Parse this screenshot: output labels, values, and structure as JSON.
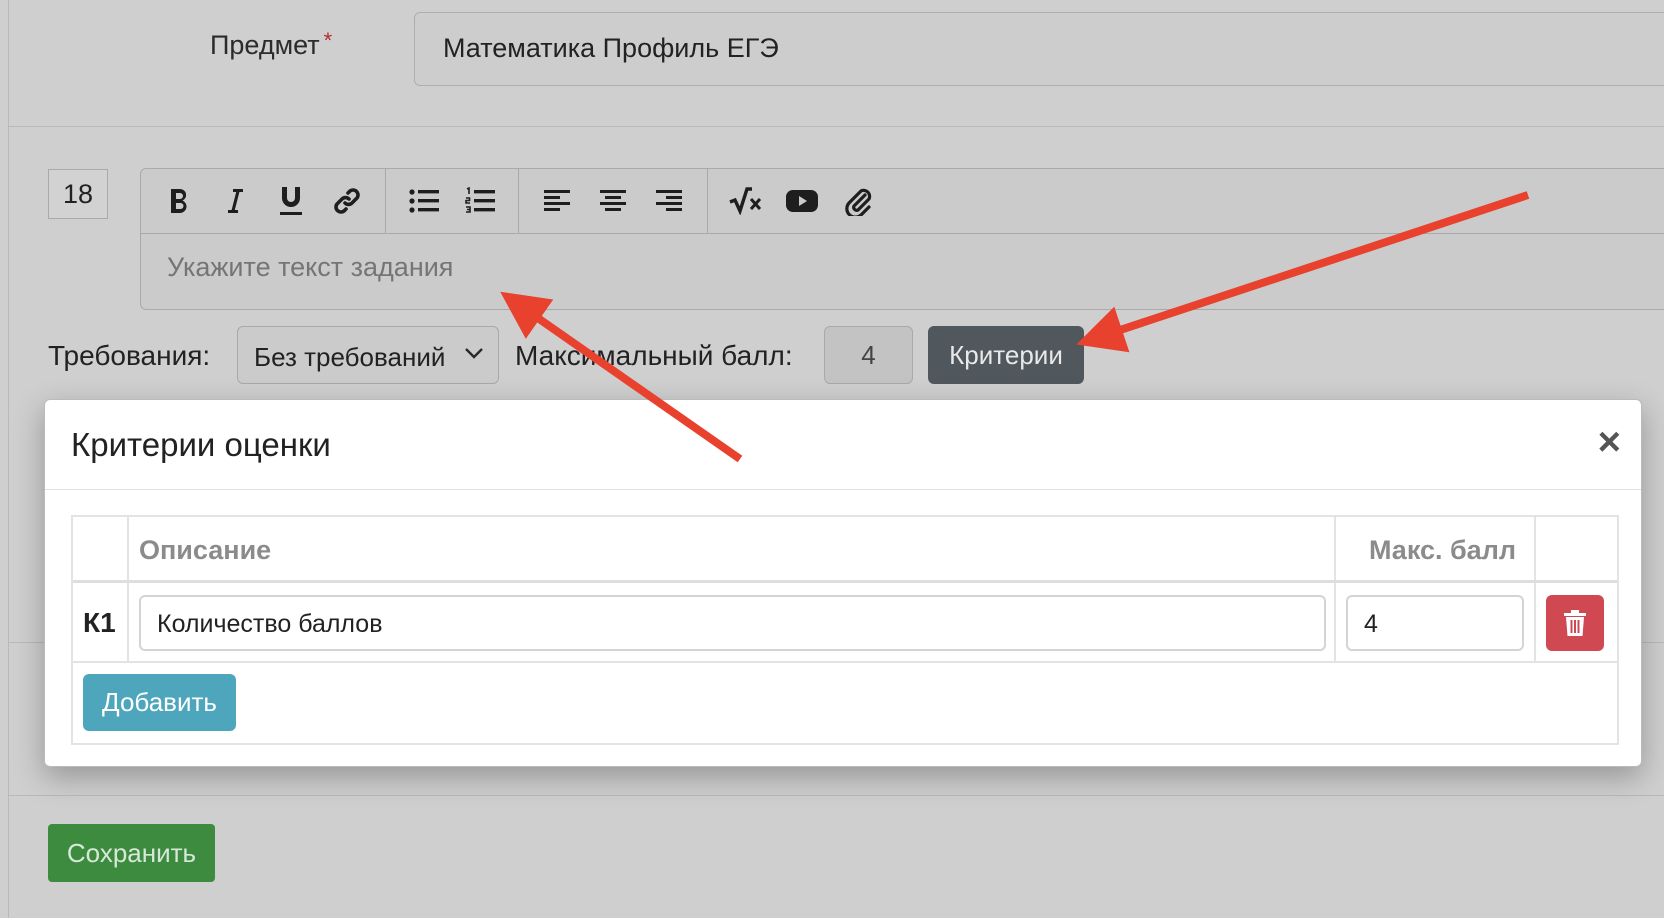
{
  "form": {
    "subject_label": "Предмет",
    "required_mark": "*",
    "subject_value": "Математика Профиль ЕГЭ",
    "question_number": "18",
    "editor_placeholder": "Укажите текст задания",
    "requirements_label": "Требования:",
    "requirements_value": "Без требований",
    "max_score_label": "Максимальный балл:",
    "max_score_value": "4",
    "criteria_button": "Критерии",
    "save_button": "Сохранить"
  },
  "toolbar": {
    "groups": [
      [
        "bold-icon",
        "italic-icon",
        "underline-icon",
        "link-icon"
      ],
      [
        "bullet-list-icon",
        "numbered-list-icon"
      ],
      [
        "align-left-icon",
        "align-center-icon",
        "align-right-icon"
      ],
      [
        "formula-icon",
        "youtube-icon",
        "paperclip-icon"
      ]
    ]
  },
  "modal": {
    "title": "Критерии оценки",
    "close": "×",
    "columns": [
      "",
      "Описание",
      "Макс. балл",
      ""
    ],
    "rows": [
      {
        "id": "К1",
        "description": "Количество баллов",
        "max": "4"
      }
    ],
    "add_button": "Добавить"
  },
  "annotations": {
    "arrow_color": "#e8412d"
  },
  "colors": {
    "criteria_button": "#50575d",
    "delete_button": "#cf4852",
    "add_button": "#4ea6bd",
    "save_button": "#3c8b3f"
  }
}
